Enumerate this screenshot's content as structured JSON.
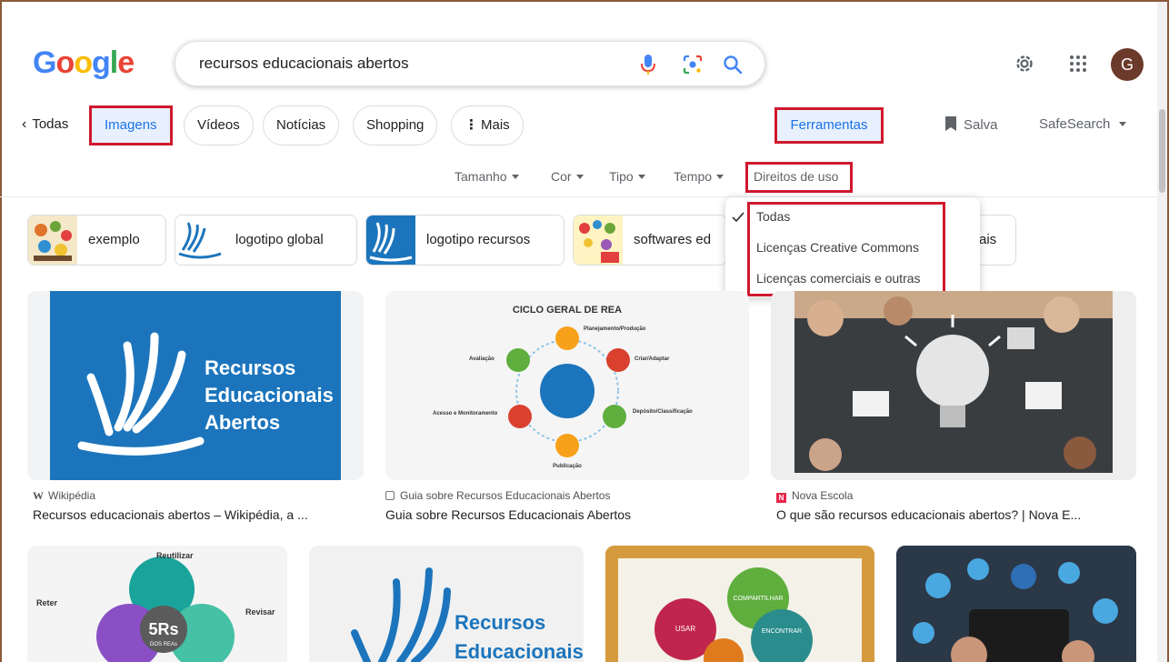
{
  "search": {
    "query": "recursos educacionais abertos"
  },
  "header": {
    "avatar_letter": "G"
  },
  "tabs": {
    "back_label": "Todas",
    "items": [
      "Imagens",
      "Vídeos",
      "Notícias",
      "Shopping",
      "Mais"
    ],
    "more_prefix": "⋮",
    "tools_label": "Ferramentas",
    "save_label": "Salva",
    "safesearch_label": "SafeSearch"
  },
  "filters": [
    "Tamanho",
    "Cor",
    "Tipo",
    "Tempo",
    "Direitos de uso"
  ],
  "usage_rights_menu": {
    "options": [
      "Todas",
      "Licenças Creative Commons",
      "Licenças comerciais e outras"
    ],
    "selected": "Todas"
  },
  "suggestions": [
    "exemplo",
    "logotipo global",
    "logotipo recursos",
    "softwares ed",
    "ais"
  ],
  "results": [
    {
      "source": "Wikipédia",
      "title": "Recursos educacionais abertos – Wikipédia, a ...",
      "image_text": [
        "Recursos",
        "Educacionais",
        "Abertos"
      ]
    },
    {
      "source": "Guia sobre Recursos Educacionais Abertos",
      "title": "Guia sobre Recursos Educacionais Abertos",
      "image_text": [
        "CICLO GERAL DE REA",
        "Planejamento/Produção",
        "Criar/Adaptar",
        "Depósito/Classificação",
        "Publicação",
        "Acesso e Monitoramento",
        "Avaliação"
      ]
    },
    {
      "source": "Nova Escola",
      "title": "O que são recursos educacionais abertos? | Nova E..."
    }
  ],
  "row2_images": [
    {
      "image_text": [
        "Reutilizar",
        "Reter",
        "Revisar",
        "5Rs",
        "DOS REAs"
      ]
    },
    {
      "image_text": [
        "Recursos",
        "Educacionais"
      ]
    },
    {
      "image_text": [
        "COMPARTILHAR",
        "USAR",
        "ENCONTRAR"
      ]
    },
    {
      "image_text": []
    }
  ],
  "colors": {
    "google_blue": "#4285f4",
    "google_red": "#ea4335",
    "google_yellow": "#fbbc05",
    "google_green": "#34a853",
    "highlight_red": "#d0182e",
    "rea_blue": "#1c75bc",
    "link_blue": "#1a73e8"
  }
}
